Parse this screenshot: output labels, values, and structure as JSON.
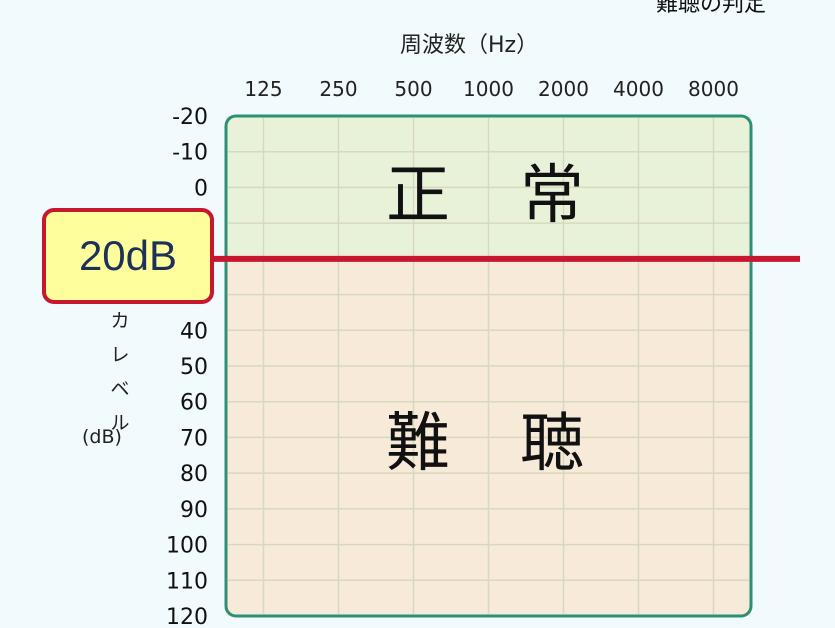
{
  "page": {
    "top_cut_text": "難聴の判定",
    "ylabel_vertical_chars": "カレベル",
    "ylabel_unit": "(dB)",
    "zone_normal": "正常",
    "zone_hearing_loss": "難聴",
    "threshold_label": "20dB"
  },
  "colors": {
    "background": "#f1fafc",
    "normal_fill": "#e8f2d9",
    "hearing_fill": "#f7ead8",
    "grid": "#d7d8be",
    "border": "#2d8f73",
    "threshold": "#c7172f",
    "label_fill": "#fffe9d"
  },
  "chart_data": {
    "type": "heatmap",
    "title": "",
    "xlabel": "周波数（Hz）",
    "ylabel": "カレベル (dB)",
    "x_categories": [
      "125",
      "250",
      "500",
      "1000",
      "2000",
      "4000",
      "8000"
    ],
    "y_ticks": [
      "-20",
      "-10",
      "0",
      "40",
      "50",
      "60",
      "70",
      "80",
      "90",
      "100",
      "110",
      "120"
    ],
    "y_range": [
      -20,
      120
    ],
    "zones": [
      {
        "name": "正常",
        "from": -20,
        "to": 20,
        "color": "#e8f2d9"
      },
      {
        "name": "難聴",
        "from": 20,
        "to": 120,
        "color": "#f7ead8"
      }
    ],
    "threshold": {
      "value": 20,
      "label": "20dB"
    },
    "grid": true,
    "legend": "none"
  }
}
